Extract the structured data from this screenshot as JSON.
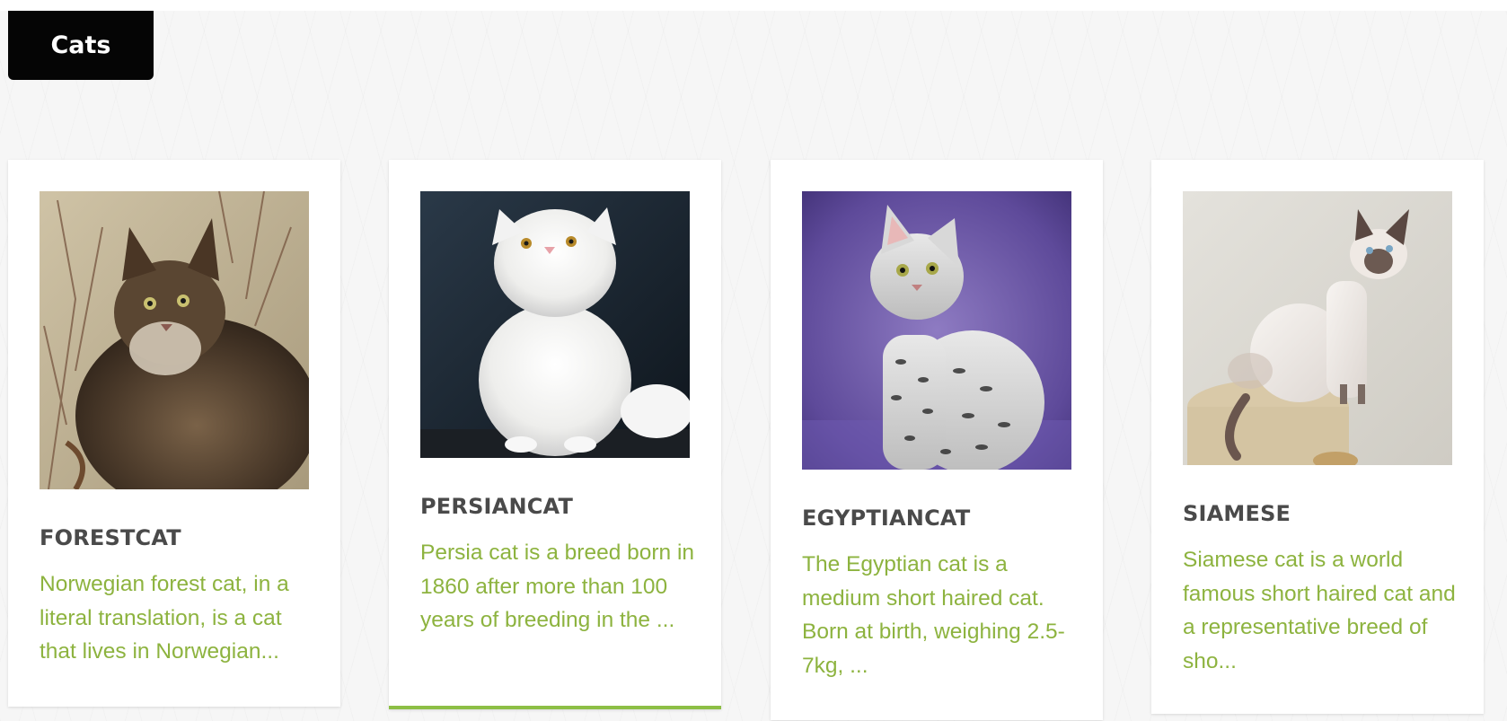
{
  "section_tab": {
    "label": "Cats"
  },
  "cards": [
    {
      "name": "FORESTCAT",
      "description": "Norwegian forest cat, in a literal translation, is a cat that lives in Norwegian...",
      "image_icon": "forest-cat-photo"
    },
    {
      "name": "PERSIANCAT",
      "description": "Persia cat is a breed born in 1860 after more than 100 years of breeding in the ...",
      "image_icon": "persian-cat-photo"
    },
    {
      "name": "EGYPTIANCAT",
      "description": "The Egyptian cat is a medium short haired cat. Born at birth, weighing 2.5-7kg, ...",
      "image_icon": "egyptian-cat-photo"
    },
    {
      "name": "SIAMESE",
      "description": "Siamese cat is a world famous short haired cat and a representative breed of sho...",
      "image_icon": "siamese-cat-photo"
    }
  ],
  "colors": {
    "tab_background": "#050505",
    "title_text": "#4a4a4a",
    "description_text": "#8db33f",
    "active_underline": "#8dbf45"
  }
}
